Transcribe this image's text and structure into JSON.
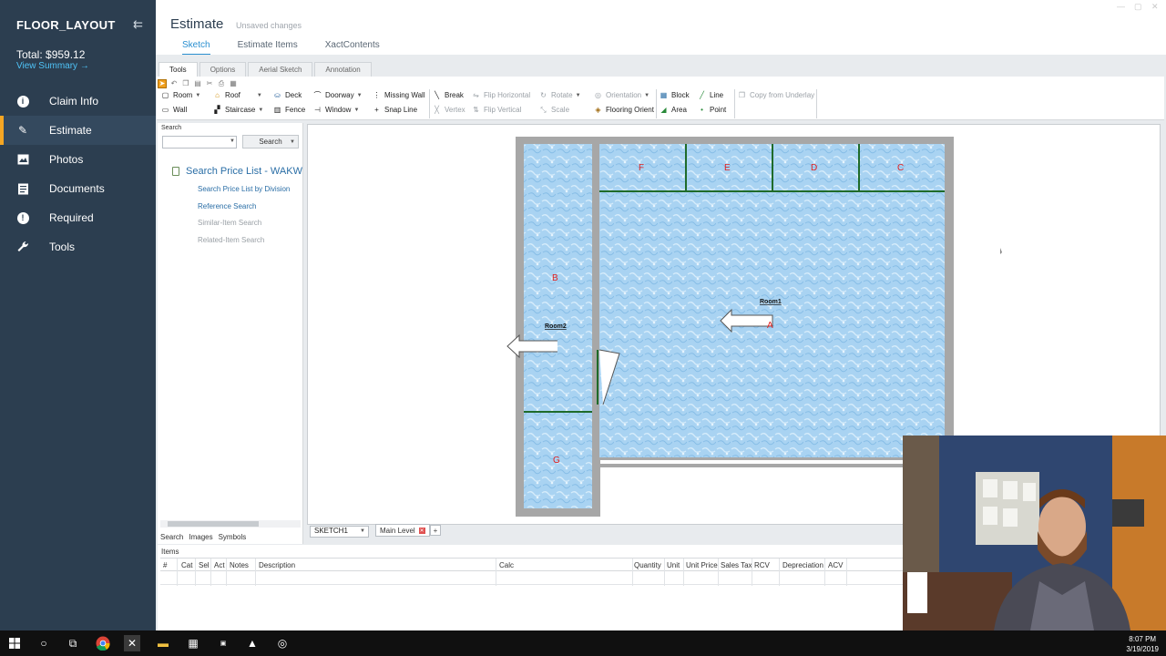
{
  "sidebar": {
    "title": "FLOOR_LAYOUT",
    "total": "Total: $959.12",
    "view_summary": "View Summary →",
    "items": [
      {
        "label": "Claim Info",
        "icon": "info-icon"
      },
      {
        "label": "Estimate",
        "icon": "pencil-icon"
      },
      {
        "label": "Photos",
        "icon": "photos-icon"
      },
      {
        "label": "Documents",
        "icon": "documents-icon"
      },
      {
        "label": "Required",
        "icon": "required-icon"
      },
      {
        "label": "Tools",
        "icon": "wrench-icon"
      }
    ],
    "active_item": "Estimate"
  },
  "header": {
    "title": "Estimate",
    "unsaved": "Unsaved changes",
    "tabs": [
      "Sketch",
      "Estimate Items",
      "XactContents"
    ],
    "active_tab": "Sketch"
  },
  "ribbon": {
    "tabs": [
      "Tools",
      "Options",
      "Aerial Sketch",
      "Annotation"
    ],
    "active_tab": "Tools",
    "buttons": {
      "room": "Room",
      "wall": "Wall",
      "roof": "Roof",
      "staircase": "Staircase",
      "deck": "Deck",
      "fence": "Fence",
      "doorway": "Doorway",
      "window": "Window",
      "missing_wall": "Missing Wall",
      "snap_line": "Snap Line",
      "break": "Break",
      "vertex": "Vertex",
      "flip_horizontal": "Flip Horizontal",
      "flip_vertical": "Flip Vertical",
      "rotate": "Rotate",
      "scale": "Scale",
      "orientation": "Orientation",
      "flooring_orient": "Flooring Orient",
      "block": "Block",
      "area": "Area",
      "line": "Line",
      "point": "Point",
      "copy_from_underlay": "Copy from Underlay"
    }
  },
  "search_panel": {
    "label": "Search",
    "search_button": "Search",
    "price_list_title": "Search Price List - WAKW",
    "links": [
      {
        "label": "Search Price List by Division",
        "enabled": true
      },
      {
        "label": "Reference Search",
        "enabled": true
      },
      {
        "label": "Similar-Item Search",
        "enabled": false
      },
      {
        "label": "Related-Item Search",
        "enabled": false
      }
    ],
    "bottom_tabs": [
      "Search",
      "Images",
      "Symbols"
    ]
  },
  "sketch": {
    "sketch_name": "SKETCH1",
    "level": "Main Level",
    "rooms": [
      "Room1",
      "Room2"
    ],
    "wall_labels": [
      "A",
      "B",
      "C",
      "D",
      "E",
      "F",
      "G"
    ],
    "floor_color": "#a9d3f2",
    "wall_color": "#a7a7a7",
    "label_color": "#e02020"
  },
  "items": {
    "label": "Items",
    "columns": [
      "#",
      "Cat",
      "Sel",
      "Act",
      "Notes",
      "Description",
      "Calc",
      "Quantity",
      "Unit",
      "Unit Price",
      "Sales Tax",
      "RCV",
      "Depreciation",
      "ACV"
    ]
  },
  "taskbar": {
    "time": "8:07 PM",
    "date": "3/19/2019"
  }
}
